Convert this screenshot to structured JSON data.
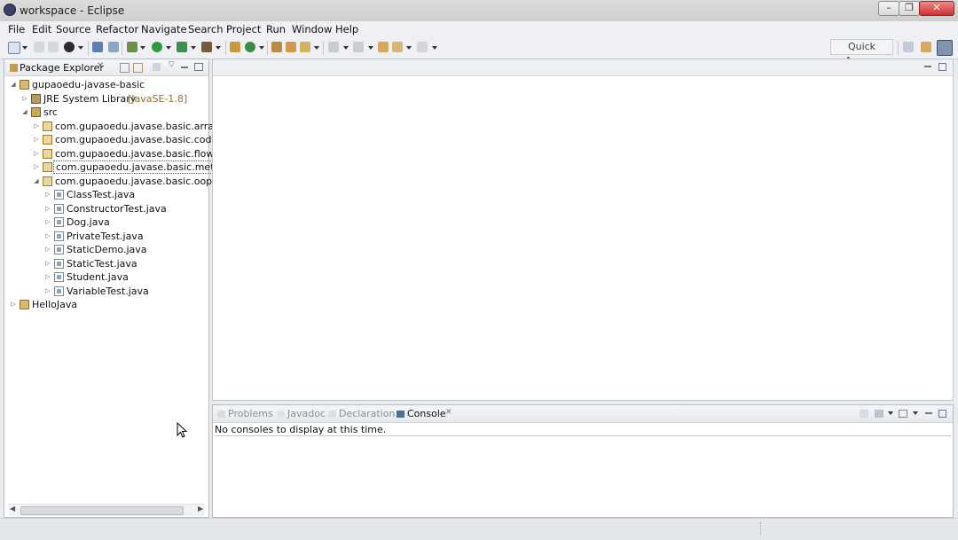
{
  "window": {
    "title": "workspace - Eclipse",
    "buttons": [
      "–",
      "❐",
      "✕"
    ]
  },
  "menu": [
    "File",
    "Edit",
    "Source",
    "Refactor",
    "Navigate",
    "Search",
    "Project",
    "Run",
    "Window",
    "Help"
  ],
  "toolbar": {
    "quick_access": "Quick Access"
  },
  "package_explorer": {
    "tab_label": "Package Explorer",
    "tree": {
      "project": "gupaoedu-javase-basic",
      "jre_label": "JRE System Library",
      "jre_version": "[JavaSE-1.8]",
      "src": "src",
      "packages": [
        "com.gupaoedu.javase.basic.array",
        "com.gupaoedu.javase.basic.codebl",
        "com.gupaoedu.javase.basic.flowcor",
        "com.gupaoedu.javase.basic.methoc",
        "com.gupaoedu.javase.basic.oop"
      ],
      "files": [
        "ClassTest.java",
        "ConstructorTest.java",
        "Dog.java",
        "PrivateTest.java",
        "StaticDemo.java",
        "StaticTest.java",
        "Student.java",
        "VariableTest.java"
      ],
      "other_project": "HelloJava"
    }
  },
  "console": {
    "tabs": [
      "Problems",
      "Javadoc",
      "Declaration",
      "Console"
    ],
    "active_tab": "Console",
    "message": "No consoles to display at this time."
  },
  "colors": {
    "title_bg": "#d4d4d4",
    "toolbar_bg": "#eef0f3",
    "panel_border": "#b7bcc3"
  }
}
